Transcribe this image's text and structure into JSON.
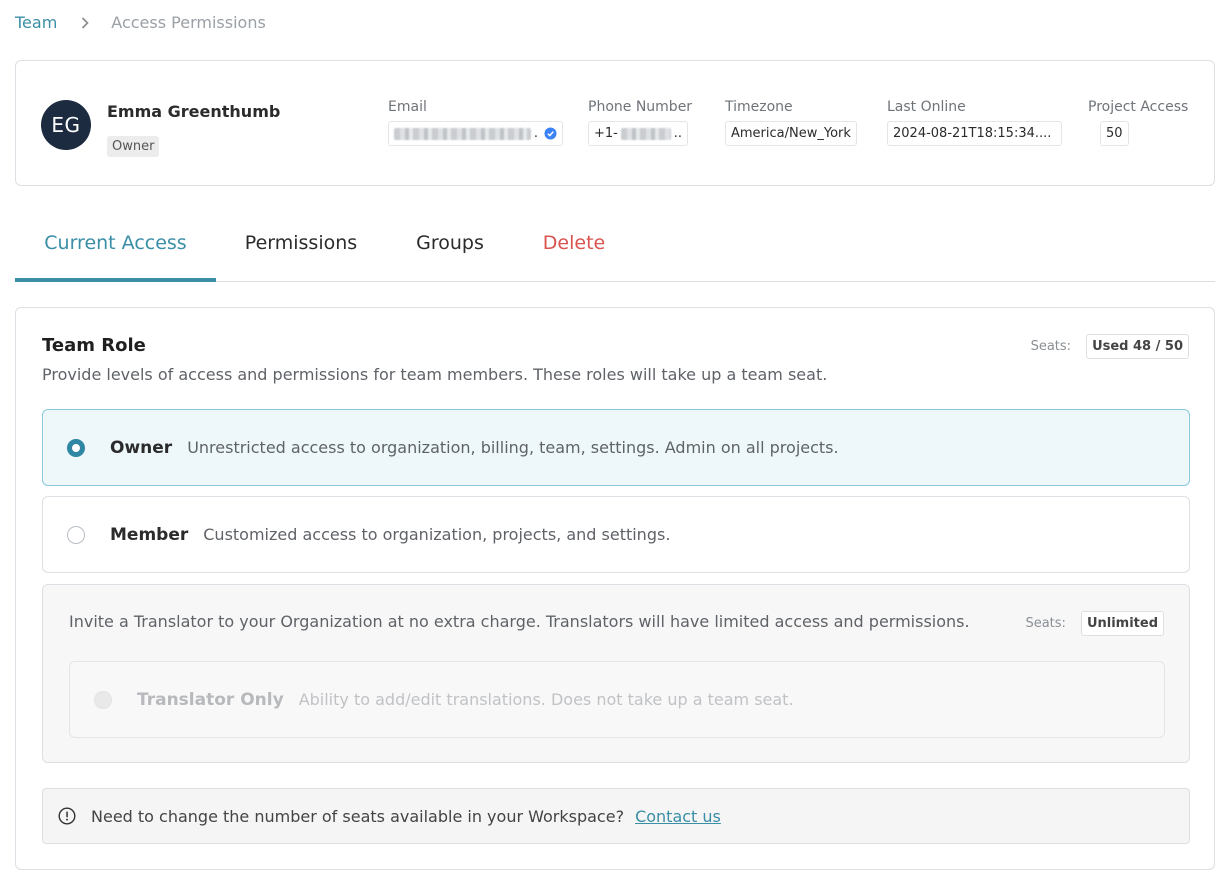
{
  "breadcrumb": {
    "parent": "Team",
    "current": "Access Permissions"
  },
  "user": {
    "initials": "EG",
    "name": "Emma Greenthumb",
    "role": "Owner",
    "email_label": "Email",
    "email_suffix": ".",
    "phone_label": "Phone Number",
    "phone_prefix": "+1-",
    "phone_suffix": "..",
    "timezone_label": "Timezone",
    "timezone": "America/New_York",
    "last_online_label": "Last Online",
    "last_online": "2024-08-21T18:15:34....",
    "project_access_label": "Project Access",
    "project_access": "50"
  },
  "tabs": [
    {
      "label": "Current Access",
      "active": true
    },
    {
      "label": "Permissions"
    },
    {
      "label": "Groups"
    },
    {
      "label": "Delete"
    }
  ],
  "team_role": {
    "title": "Team Role",
    "description": "Provide levels of access and permissions for team members. These roles will take up a team seat.",
    "seats_label": "Seats:",
    "seats_value": "Used 48 / 50",
    "options": [
      {
        "title": "Owner",
        "description": "Unrestricted access to organization, billing, team, settings. Admin on all projects.",
        "selected": true
      },
      {
        "title": "Member",
        "description": "Customized access to organization, projects, and settings.",
        "selected": false
      }
    ]
  },
  "translator": {
    "text": "Invite a Translator to your Organization at no extra charge. Translators will have limited access and permissions.",
    "seats_label": "Seats:",
    "seats_value": "Unlimited",
    "option_title": "Translator Only",
    "option_description": "Ability to add/edit translations. Does not take up a team seat."
  },
  "notice": {
    "text": "Need to change the number of seats available in your Workspace?",
    "link": "Contact us"
  },
  "colors": {
    "accent": "#3a8ea6",
    "danger": "#d9534f",
    "avatar_bg": "#1c2b40",
    "selected_bg": "#eef8fb"
  },
  "icons": {
    "breadcrumb_separator": "chevron-right-icon",
    "email_verified": "verified-check-icon",
    "notice": "info-circle-icon"
  }
}
